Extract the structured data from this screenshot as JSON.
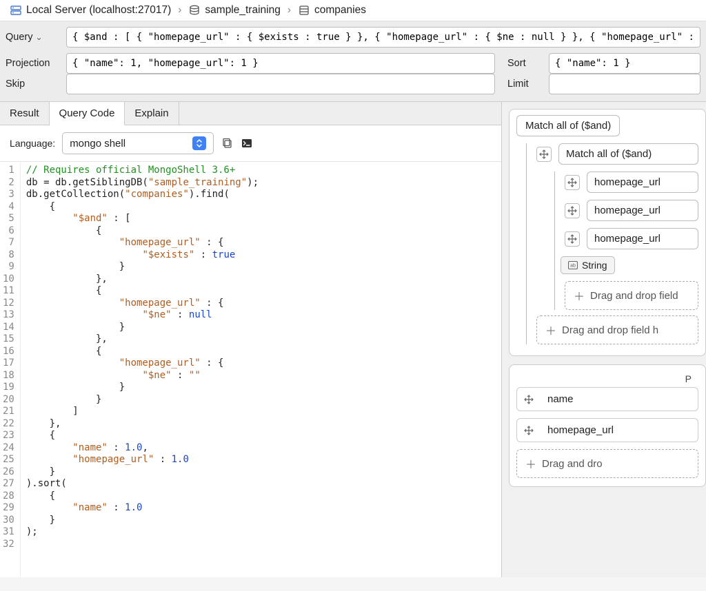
{
  "breadcrumb": {
    "server": "Local Server (localhost:27017)",
    "database": "sample_training",
    "collection": "companies"
  },
  "queryBar": {
    "queryLabel": "Query",
    "queryValue": "{ $and : [ { \"homepage_url\" : { $exists : true } }, { \"homepage_url\" : { $ne : null } }, { \"homepage_url\" : { $ne : \"\" } } ] }",
    "projectionLabel": "Projection",
    "projectionValue": "{ \"name\": 1, \"homepage_url\": 1 }",
    "sortLabel": "Sort",
    "sortValue": "{ \"name\": 1 }",
    "skipLabel": "Skip",
    "skipValue": "",
    "limitLabel": "Limit",
    "limitValue": ""
  },
  "tabs": {
    "result": "Result",
    "queryCode": "Query Code",
    "explain": "Explain"
  },
  "language": {
    "label": "Language:",
    "selected": "mongo shell"
  },
  "code": {
    "lines": [
      "// Requires official MongoShell 3.6+",
      "db = db.getSiblingDB(\"sample_training\");",
      "db.getCollection(\"companies\").find(",
      "    {",
      "        \"$and\" : [",
      "            {",
      "                \"homepage_url\" : {",
      "                    \"$exists\" : true",
      "                }",
      "            },",
      "            {",
      "                \"homepage_url\" : {",
      "                    \"$ne\" : null",
      "                }",
      "            },",
      "            {",
      "                \"homepage_url\" : {",
      "                    \"$ne\" : \"\"",
      "                }",
      "            }",
      "        ]",
      "    },",
      "    {",
      "        \"name\" : 1.0,",
      "        \"homepage_url\" : 1.0",
      "    }",
      ").sort(",
      "    {",
      "        \"name\" : 1.0",
      "    }",
      ");",
      ""
    ]
  },
  "visualQuery": {
    "rootLabel": "Match all of ($and)",
    "nestedLabel": "Match all of ($and)",
    "fields": [
      "homepage_url",
      "homepage_url",
      "homepage_url"
    ],
    "typePill": "String",
    "dropInner": "Drag and drop field",
    "dropOuter": "Drag and drop field h",
    "projLabel": "P",
    "projFields": [
      "name",
      "homepage_url"
    ],
    "dropProj": "Drag and dro"
  }
}
